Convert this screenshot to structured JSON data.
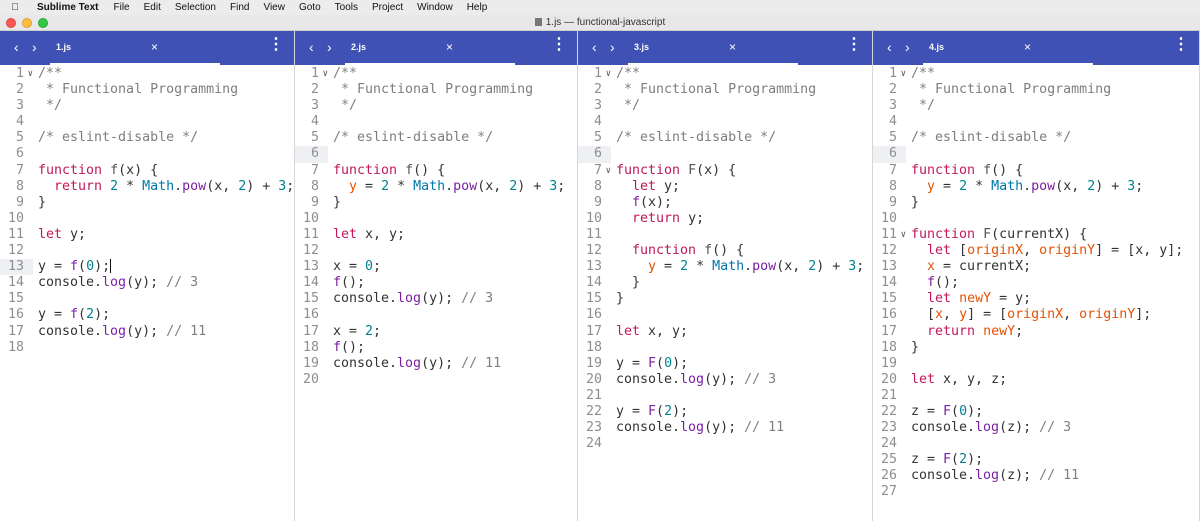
{
  "menubar": {
    "app": "Sublime Text",
    "items": [
      "File",
      "Edit",
      "Selection",
      "Find",
      "View",
      "Goto",
      "Tools",
      "Project",
      "Window",
      "Help"
    ]
  },
  "window": {
    "title": "1.js — functional-javascript"
  },
  "colors": {
    "tabbar": "#3f51b5",
    "keyword": "#c2185b",
    "number": "#00838f",
    "class": "#0077aa",
    "variable": "#e65100",
    "comment": "#7e7e7e"
  },
  "icons": {
    "back": "chevron-left-icon",
    "forward": "chevron-right-icon",
    "close": "close-icon",
    "menu": "more-vertical-icon"
  },
  "panes": [
    {
      "tab": "1.js",
      "highlight_line": 13,
      "cursor_line": 13,
      "fold_lines": [
        1
      ],
      "lines": [
        [
          [
            "/**",
            "cm"
          ]
        ],
        [
          [
            " * Functional Programming",
            "cm"
          ]
        ],
        [
          [
            " */",
            "cm"
          ]
        ],
        [],
        [
          [
            "/* eslint-disable */",
            "cm"
          ]
        ],
        [],
        [
          [
            "function",
            "kw"
          ],
          [
            " ",
            "pl"
          ],
          [
            "f",
            "fn"
          ],
          [
            "(x) {",
            "pl"
          ]
        ],
        [
          [
            "  ",
            "pl"
          ],
          [
            "return",
            "kw"
          ],
          [
            " ",
            "pl"
          ],
          [
            "2",
            "num"
          ],
          [
            " * ",
            "pl"
          ],
          [
            "Math",
            "cls"
          ],
          [
            ".",
            "pl"
          ],
          [
            "pow",
            "fn2"
          ],
          [
            "(x, ",
            "pl"
          ],
          [
            "2",
            "num"
          ],
          [
            ") + ",
            "pl"
          ],
          [
            "3",
            "num"
          ],
          [
            ";",
            "pl"
          ]
        ],
        [
          [
            "}",
            "pl"
          ]
        ],
        [],
        [
          [
            "let",
            "kw"
          ],
          [
            " y;",
            "pl"
          ]
        ],
        [],
        [
          [
            "y = ",
            "pl"
          ],
          [
            "f",
            "fn2"
          ],
          [
            "(",
            "pl"
          ],
          [
            "0",
            "num"
          ],
          [
            ");",
            "pl"
          ]
        ],
        [
          [
            "console.",
            "pl"
          ],
          [
            "log",
            "fn2"
          ],
          [
            "(y); ",
            "pl"
          ],
          [
            "// 3",
            "cm"
          ]
        ],
        [],
        [
          [
            "y = ",
            "pl"
          ],
          [
            "f",
            "fn2"
          ],
          [
            "(",
            "pl"
          ],
          [
            "2",
            "num"
          ],
          [
            ");",
            "pl"
          ]
        ],
        [
          [
            "console.",
            "pl"
          ],
          [
            "log",
            "fn2"
          ],
          [
            "(y); ",
            "pl"
          ],
          [
            "// 11",
            "cm"
          ]
        ],
        []
      ]
    },
    {
      "tab": "2.js",
      "highlight_line": 6,
      "cursor_line": 0,
      "fold_lines": [
        1
      ],
      "lines": [
        [
          [
            "/**",
            "cm"
          ]
        ],
        [
          [
            " * Functional Programming",
            "cm"
          ]
        ],
        [
          [
            " */",
            "cm"
          ]
        ],
        [],
        [
          [
            "/* eslint-disable */",
            "cm"
          ]
        ],
        [],
        [
          [
            "function",
            "kw"
          ],
          [
            " ",
            "pl"
          ],
          [
            "f",
            "fn"
          ],
          [
            "() {",
            "pl"
          ]
        ],
        [
          [
            "  ",
            "pl"
          ],
          [
            "y",
            "var"
          ],
          [
            " = ",
            "pl"
          ],
          [
            "2",
            "num"
          ],
          [
            " * ",
            "pl"
          ],
          [
            "Math",
            "cls"
          ],
          [
            ".",
            "pl"
          ],
          [
            "pow",
            "fn2"
          ],
          [
            "(x, ",
            "pl"
          ],
          [
            "2",
            "num"
          ],
          [
            ") + ",
            "pl"
          ],
          [
            "3",
            "num"
          ],
          [
            ";",
            "pl"
          ]
        ],
        [
          [
            "}",
            "pl"
          ]
        ],
        [],
        [
          [
            "let",
            "kw"
          ],
          [
            " x, y;",
            "pl"
          ]
        ],
        [],
        [
          [
            "x = ",
            "pl"
          ],
          [
            "0",
            "num"
          ],
          [
            ";",
            "pl"
          ]
        ],
        [
          [
            "f",
            "fn2"
          ],
          [
            "();",
            "pl"
          ]
        ],
        [
          [
            "console.",
            "pl"
          ],
          [
            "log",
            "fn2"
          ],
          [
            "(y); ",
            "pl"
          ],
          [
            "// 3",
            "cm"
          ]
        ],
        [],
        [
          [
            "x = ",
            "pl"
          ],
          [
            "2",
            "num"
          ],
          [
            ";",
            "pl"
          ]
        ],
        [
          [
            "f",
            "fn2"
          ],
          [
            "();",
            "pl"
          ]
        ],
        [
          [
            "console.",
            "pl"
          ],
          [
            "log",
            "fn2"
          ],
          [
            "(y); ",
            "pl"
          ],
          [
            "// 11",
            "cm"
          ]
        ],
        []
      ]
    },
    {
      "tab": "3.js",
      "highlight_line": 6,
      "cursor_line": 0,
      "fold_lines": [
        1,
        7
      ],
      "lines": [
        [
          [
            "/**",
            "cm"
          ]
        ],
        [
          [
            " * Functional Programming",
            "cm"
          ]
        ],
        [
          [
            " */",
            "cm"
          ]
        ],
        [],
        [
          [
            "/* eslint-disable */",
            "cm"
          ]
        ],
        [],
        [
          [
            "function",
            "kw"
          ],
          [
            " ",
            "pl"
          ],
          [
            "F",
            "fn"
          ],
          [
            "(x) {",
            "pl"
          ]
        ],
        [
          [
            "  ",
            "pl"
          ],
          [
            "let",
            "kw"
          ],
          [
            " y;",
            "pl"
          ]
        ],
        [
          [
            "  ",
            "pl"
          ],
          [
            "f",
            "fn2"
          ],
          [
            "(x);",
            "pl"
          ]
        ],
        [
          [
            "  ",
            "pl"
          ],
          [
            "return",
            "kw"
          ],
          [
            " y;",
            "pl"
          ]
        ],
        [],
        [
          [
            "  ",
            "pl"
          ],
          [
            "function",
            "kw"
          ],
          [
            " ",
            "pl"
          ],
          [
            "f",
            "fn"
          ],
          [
            "() {",
            "pl"
          ]
        ],
        [
          [
            "    ",
            "pl"
          ],
          [
            "y",
            "var"
          ],
          [
            " = ",
            "pl"
          ],
          [
            "2",
            "num"
          ],
          [
            " * ",
            "pl"
          ],
          [
            "Math",
            "cls"
          ],
          [
            ".",
            "pl"
          ],
          [
            "pow",
            "fn2"
          ],
          [
            "(x, ",
            "pl"
          ],
          [
            "2",
            "num"
          ],
          [
            ") + ",
            "pl"
          ],
          [
            "3",
            "num"
          ],
          [
            ";",
            "pl"
          ]
        ],
        [
          [
            "  }",
            "pl"
          ]
        ],
        [
          [
            "}",
            "pl"
          ]
        ],
        [],
        [
          [
            "let",
            "kw"
          ],
          [
            " x, y;",
            "pl"
          ]
        ],
        [],
        [
          [
            "y = ",
            "pl"
          ],
          [
            "F",
            "fn2"
          ],
          [
            "(",
            "pl"
          ],
          [
            "0",
            "num"
          ],
          [
            ");",
            "pl"
          ]
        ],
        [
          [
            "console.",
            "pl"
          ],
          [
            "log",
            "fn2"
          ],
          [
            "(y); ",
            "pl"
          ],
          [
            "// 3",
            "cm"
          ]
        ],
        [],
        [
          [
            "y = ",
            "pl"
          ],
          [
            "F",
            "fn2"
          ],
          [
            "(",
            "pl"
          ],
          [
            "2",
            "num"
          ],
          [
            ");",
            "pl"
          ]
        ],
        [
          [
            "console.",
            "pl"
          ],
          [
            "log",
            "fn2"
          ],
          [
            "(y); ",
            "pl"
          ],
          [
            "// 11",
            "cm"
          ]
        ],
        []
      ]
    },
    {
      "tab": "4.js",
      "highlight_line": 6,
      "cursor_line": 0,
      "fold_lines": [
        1,
        11
      ],
      "lines": [
        [
          [
            "/**",
            "cm"
          ]
        ],
        [
          [
            " * Functional Programming",
            "cm"
          ]
        ],
        [
          [
            " */",
            "cm"
          ]
        ],
        [],
        [
          [
            "/* eslint-disable */",
            "cm"
          ]
        ],
        [],
        [
          [
            "function",
            "kw"
          ],
          [
            " ",
            "pl"
          ],
          [
            "f",
            "fn"
          ],
          [
            "() {",
            "pl"
          ]
        ],
        [
          [
            "  ",
            "pl"
          ],
          [
            "y",
            "var"
          ],
          [
            " = ",
            "pl"
          ],
          [
            "2",
            "num"
          ],
          [
            " * ",
            "pl"
          ],
          [
            "Math",
            "cls"
          ],
          [
            ".",
            "pl"
          ],
          [
            "pow",
            "fn2"
          ],
          [
            "(x, ",
            "pl"
          ],
          [
            "2",
            "num"
          ],
          [
            ") + ",
            "pl"
          ],
          [
            "3",
            "num"
          ],
          [
            ";",
            "pl"
          ]
        ],
        [
          [
            "}",
            "pl"
          ]
        ],
        [],
        [
          [
            "function",
            "kw"
          ],
          [
            " ",
            "pl"
          ],
          [
            "F",
            "fn"
          ],
          [
            "(currentX) {",
            "pl"
          ]
        ],
        [
          [
            "  ",
            "pl"
          ],
          [
            "let",
            "kw"
          ],
          [
            " [",
            "pl"
          ],
          [
            "originX",
            "var"
          ],
          [
            ", ",
            "pl"
          ],
          [
            "originY",
            "var"
          ],
          [
            "] = [x, y];",
            "pl"
          ]
        ],
        [
          [
            "  ",
            "pl"
          ],
          [
            "x",
            "var"
          ],
          [
            " = currentX;",
            "pl"
          ]
        ],
        [
          [
            "  ",
            "pl"
          ],
          [
            "f",
            "fn2"
          ],
          [
            "();",
            "pl"
          ]
        ],
        [
          [
            "  ",
            "pl"
          ],
          [
            "let",
            "kw"
          ],
          [
            " ",
            "pl"
          ],
          [
            "newY",
            "var"
          ],
          [
            " = y;",
            "pl"
          ]
        ],
        [
          [
            "  [",
            "pl"
          ],
          [
            "x",
            "var"
          ],
          [
            ", ",
            "pl"
          ],
          [
            "y",
            "var"
          ],
          [
            "] = [",
            "pl"
          ],
          [
            "originX",
            "var"
          ],
          [
            ", ",
            "pl"
          ],
          [
            "originY",
            "var"
          ],
          [
            "];",
            "pl"
          ]
        ],
        [
          [
            "  ",
            "pl"
          ],
          [
            "return",
            "kw"
          ],
          [
            " ",
            "pl"
          ],
          [
            "newY",
            "var"
          ],
          [
            ";",
            "pl"
          ]
        ],
        [
          [
            "}",
            "pl"
          ]
        ],
        [],
        [
          [
            "let",
            "kw"
          ],
          [
            " x, y, z;",
            "pl"
          ]
        ],
        [],
        [
          [
            "z = ",
            "pl"
          ],
          [
            "F",
            "fn2"
          ],
          [
            "(",
            "pl"
          ],
          [
            "0",
            "num"
          ],
          [
            ");",
            "pl"
          ]
        ],
        [
          [
            "console.",
            "pl"
          ],
          [
            "log",
            "fn2"
          ],
          [
            "(z); ",
            "pl"
          ],
          [
            "// 3",
            "cm"
          ]
        ],
        [],
        [
          [
            "z = ",
            "pl"
          ],
          [
            "F",
            "fn2"
          ],
          [
            "(",
            "pl"
          ],
          [
            "2",
            "num"
          ],
          [
            ");",
            "pl"
          ]
        ],
        [
          [
            "console.",
            "pl"
          ],
          [
            "log",
            "fn2"
          ],
          [
            "(z); ",
            "pl"
          ],
          [
            "// 11",
            "cm"
          ]
        ],
        []
      ]
    }
  ]
}
